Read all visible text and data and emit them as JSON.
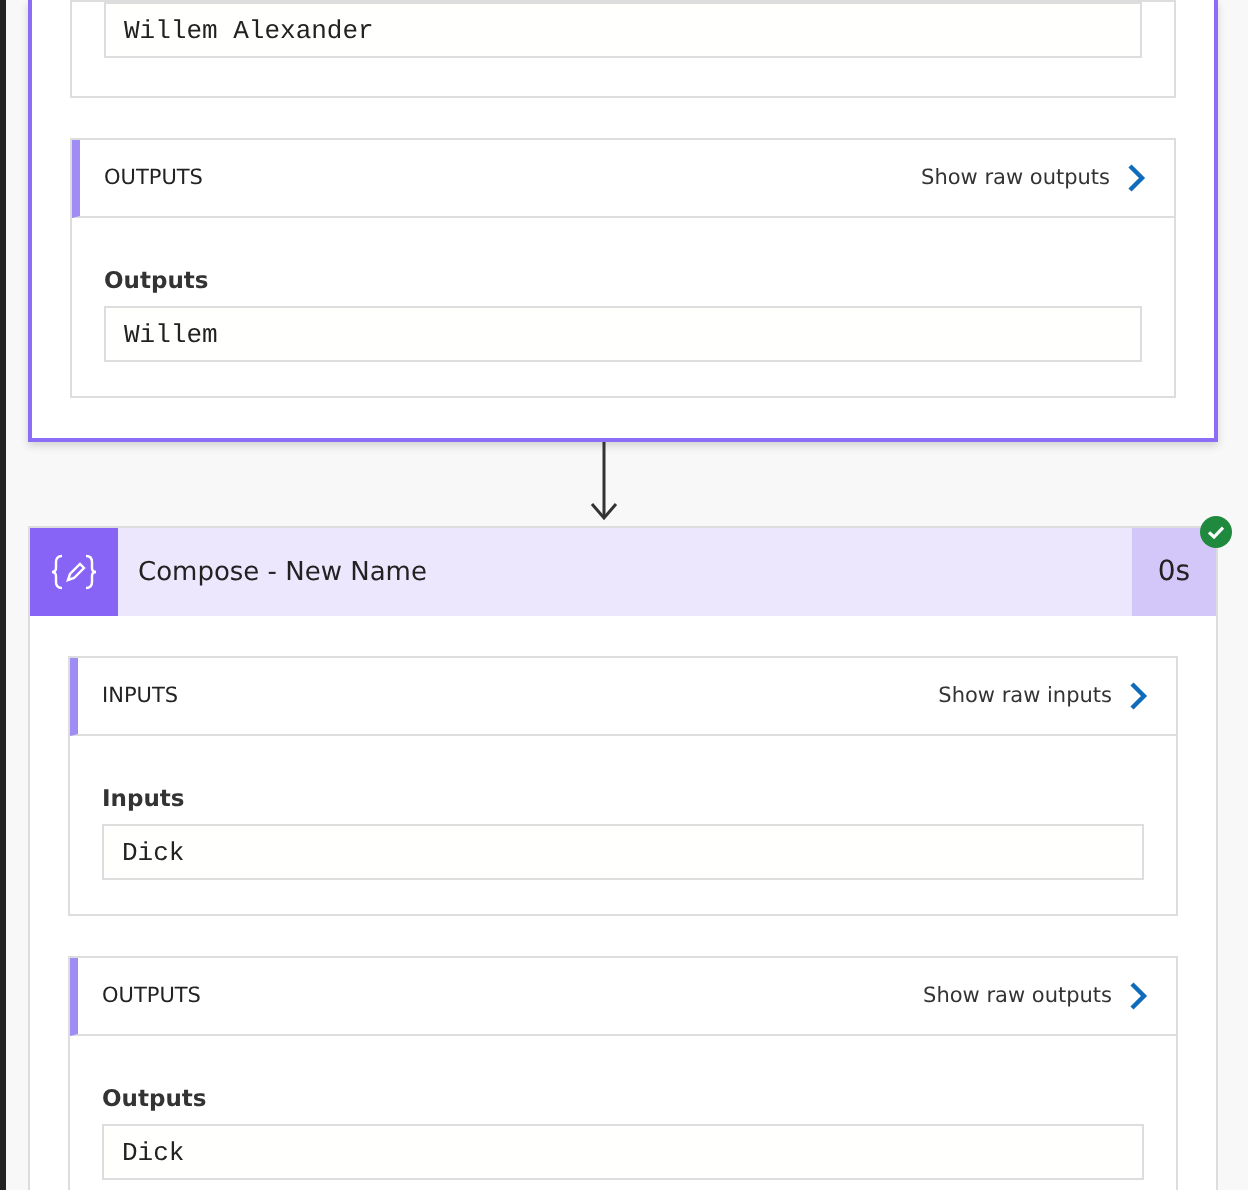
{
  "previous_action": {
    "partial_value": "Willem Alexander",
    "sections": [
      {
        "title": "OUTPUTS",
        "link": "Show raw outputs",
        "label": "Outputs",
        "value": "Willem"
      }
    ]
  },
  "action": {
    "title": "Compose - New Name",
    "duration": "0s",
    "succeeded": true,
    "sections": [
      {
        "title": "INPUTS",
        "link": "Show raw inputs",
        "label": "Inputs",
        "value": "Dick"
      },
      {
        "title": "OUTPUTS",
        "link": "Show raw outputs",
        "label": "Outputs",
        "value": "Dick"
      }
    ]
  }
}
